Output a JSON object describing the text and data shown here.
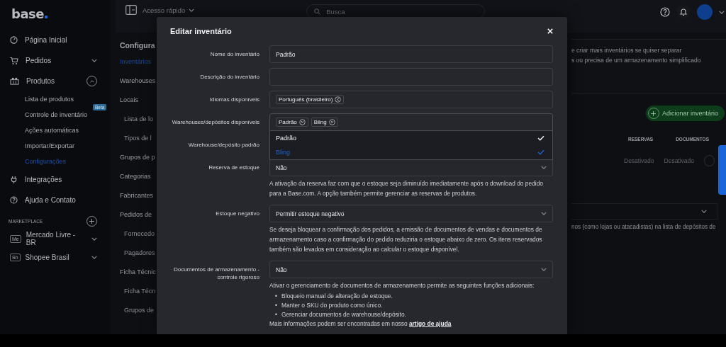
{
  "sidebar": {
    "logo": "base",
    "items": [
      {
        "label": "Página Inicial"
      },
      {
        "label": "Pedidos",
        "expanded": false
      },
      {
        "label": "Produtos",
        "expanded": true,
        "children": [
          {
            "label": "Lista de produtos",
            "selected": false
          },
          {
            "label": "Controle de inventário",
            "selected": false,
            "badge": "Beta"
          },
          {
            "label": "Ações automáticas",
            "selected": false
          },
          {
            "label": "Importar/Exportar",
            "selected": false
          },
          {
            "label": "Configurações",
            "selected": true
          }
        ]
      },
      {
        "label": "Integrações"
      },
      {
        "label": "Ajuda e Contato"
      }
    ],
    "marketplace": {
      "title": "MARKETPLACE",
      "accounts": [
        {
          "code": "Me",
          "label": "Mercado Livre - BR"
        },
        {
          "code": "Sh",
          "label": "Shopee Brasil"
        }
      ]
    }
  },
  "topbar": {
    "quick_access": "Acesso rápido",
    "search": {
      "placeholder": "Busca"
    }
  },
  "settings_nav": {
    "title": "Configura",
    "items": [
      {
        "label": "Inventários",
        "selected": true
      },
      {
        "label": "Warehouses",
        "selected": false
      },
      {
        "label": "Locais",
        "selected": false,
        "children": [
          {
            "label": "Lista de lo",
            "selected": false
          },
          {
            "label": "Tipos de l",
            "selected": false
          }
        ]
      },
      {
        "label": "Grupos de p",
        "selected": false
      },
      {
        "label": "Categorias",
        "selected": false
      },
      {
        "label": "Fabricantes",
        "selected": false
      },
      {
        "label": "Pedidos de",
        "selected": false,
        "children": [
          {
            "label": "Fornecedo",
            "selected": false
          },
          {
            "label": "Pagadores",
            "selected": false
          }
        ]
      },
      {
        "label": "Ficha Técnic",
        "selected": false,
        "children": [
          {
            "label": "Ficha Técn",
            "selected": false
          },
          {
            "label": "Grupos de",
            "selected": false
          }
        ]
      }
    ]
  },
  "background_content": {
    "info_lines": [
      "e criar mais inventários se quiser separar",
      "s ou precisa de um armazenamento simplificado"
    ],
    "add_button": "Adicionar inventário",
    "table": {
      "columns": [
        "RESERVAS",
        "DOCUMENTOS"
      ],
      "rows": [
        [
          "Desativado",
          "Desativado"
        ]
      ]
    },
    "lower_text": "nos (como lojas ou atacadistas) na lista de depósitos de"
  },
  "modal": {
    "title": "Editar inventário",
    "fields": [
      {
        "kind": "input",
        "label": "Nome do inventário",
        "value": "Padrão"
      },
      {
        "kind": "input",
        "label": "Descrição do inventário"
      },
      {
        "kind": "tags",
        "label": "Idiomas disponíveis",
        "tags": [
          "Português (brasileiro)"
        ]
      },
      {
        "kind": "multiselect",
        "label": "Warehouses/depósitos disponíveis",
        "tags": [
          "Padrão",
          "Bling"
        ],
        "expanded": true,
        "options": [
          {
            "label": "Padrão",
            "checked": true,
            "highlighted": false
          },
          {
            "label": "Bling",
            "checked": true,
            "highlighted": true
          }
        ]
      },
      {
        "kind": "hidden",
        "label": "Warehouse/depósito padrão"
      },
      {
        "kind": "select",
        "label": "Reserva de estoque",
        "value": "Não",
        "help": "A ativação da reserva faz com que o estoque seja diminuído imediatamente após o download do pedido para a Base.com. A opção também permite gerenciar as reservas de produtos."
      },
      {
        "kind": "select",
        "label": "Estoque negativo",
        "value": "Permitir estoque negativo",
        "help": "Se deseja bloquear a confirmação dos pedidos, a emissão de documentos de vendas e documentos de armazenamento caso a confirmação do pedido reduziria o estoque abaixo de zero. Os itens reservados também são levados em consideração ao calcular o estoque disponível."
      },
      {
        "kind": "select",
        "label": "Documentos de armazenamento - controle rigoroso",
        "value": "Não",
        "help": "Ativar o gerenciamento de documentos de armazenamento permite as seguintes funções adicionais:",
        "bullet_marker": "•",
        "bullets": [
          "Bloqueio manual de alteração de estoque.",
          "Manter o SKU do produto como único.",
          "Gerenciar documentos de warehouse/depósito."
        ],
        "more": "Mais informações podem ser encontradas em nosso",
        "link": "artigo de ajuda"
      }
    ]
  }
}
